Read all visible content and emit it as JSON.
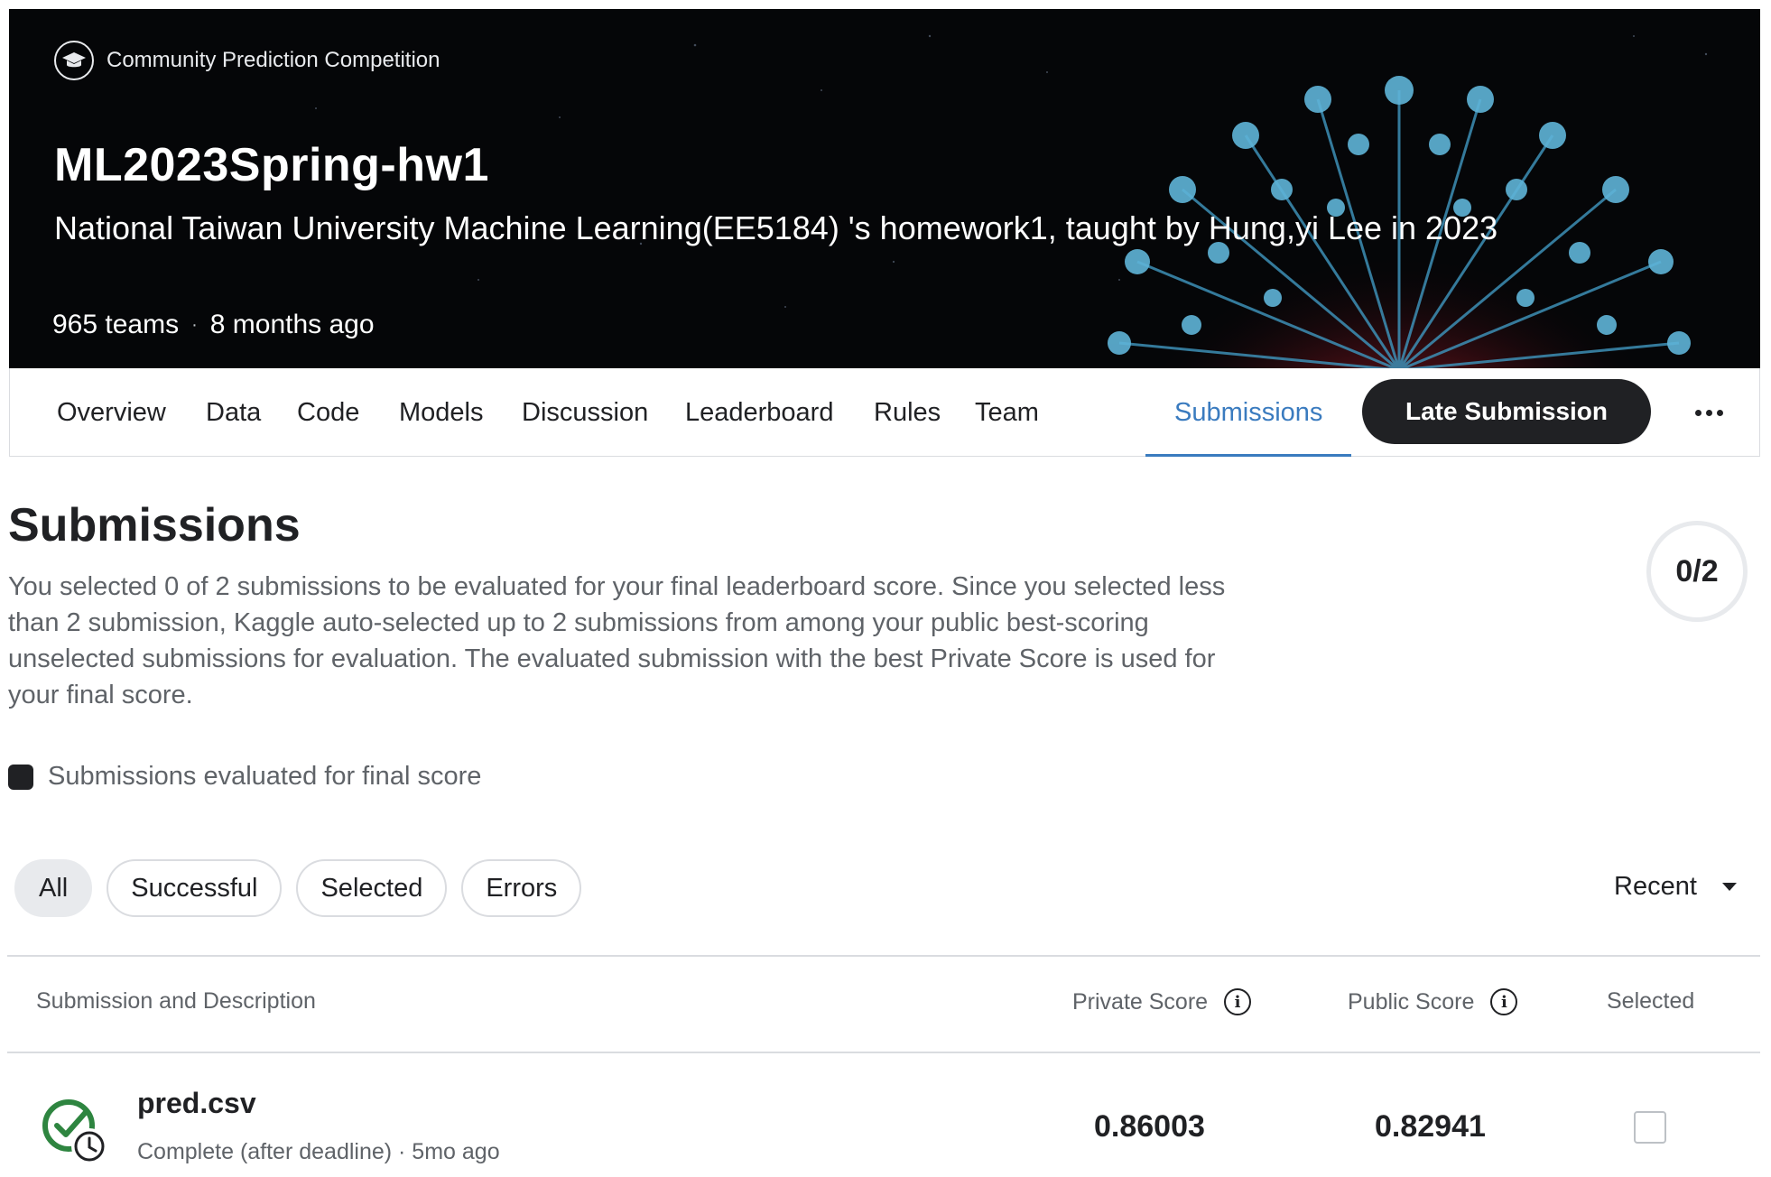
{
  "header": {
    "competition_type": "Community Prediction Competition",
    "title": "ML2023Spring-hw1",
    "subtitle": "National Taiwan University Machine Learning(EE5184) 's homework1, taught by Hung,yi Lee in 2023",
    "teams": "965 teams",
    "separator": "·",
    "age": "8 months ago"
  },
  "tabs": [
    {
      "label": "Overview"
    },
    {
      "label": "Data"
    },
    {
      "label": "Code"
    },
    {
      "label": "Models"
    },
    {
      "label": "Discussion"
    },
    {
      "label": "Leaderboard"
    },
    {
      "label": "Rules"
    },
    {
      "label": "Team"
    },
    {
      "label": "Submissions",
      "active": true
    }
  ],
  "late_submission_label": "Late Submission",
  "more_icon": "more-horizontal-icon",
  "submissions": {
    "title": "Submissions",
    "description": "You selected 0 of 2 submissions to be evaluated for your final leaderboard score. Since you selected less than 2 submission, Kaggle auto-selected up to 2 submissions from among your public best-scoring unselected submissions for evaluation. The evaluated submission with the best Private Score is used for your final score.",
    "counter": "0/2",
    "legend": "Submissions evaluated for final score"
  },
  "filters": [
    "All",
    "Successful",
    "Selected",
    "Errors"
  ],
  "sort": {
    "label": "Recent"
  },
  "table": {
    "headers": {
      "submission": "Submission and Description",
      "private": "Private Score",
      "public": "Public Score",
      "selected": "Selected"
    },
    "rows": [
      {
        "file": "pred.csv",
        "status": "Complete (after deadline) · 5mo ago",
        "private_score": "0.86003",
        "public_score": "0.82941",
        "selected": false
      }
    ]
  },
  "colors": {
    "active_tab": "#3a7bbf",
    "success_green": "#2e8540",
    "dark": "#202124"
  }
}
